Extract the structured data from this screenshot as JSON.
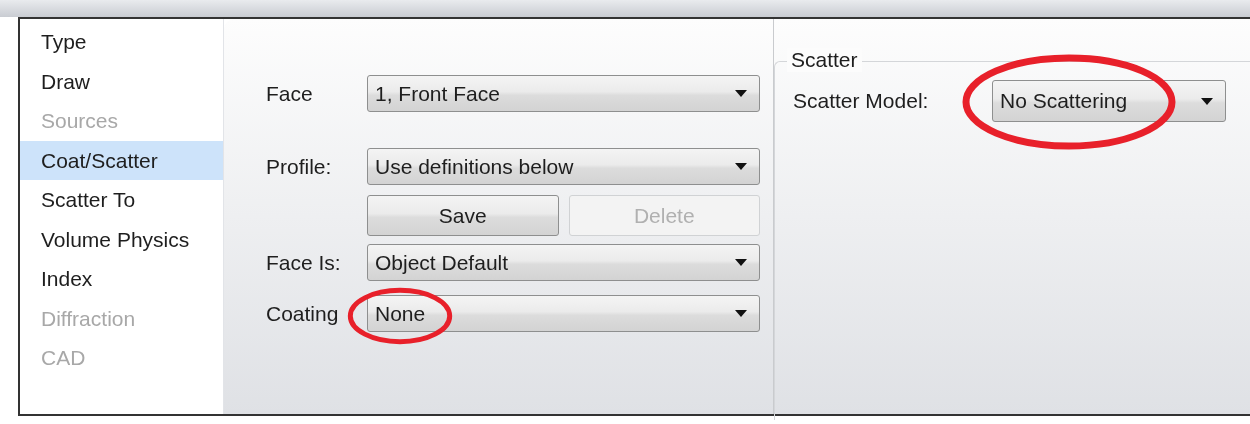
{
  "sidebar": {
    "items": [
      {
        "label": "Type",
        "selected": false,
        "disabled": false
      },
      {
        "label": "Draw",
        "selected": false,
        "disabled": false
      },
      {
        "label": "Sources",
        "selected": false,
        "disabled": true
      },
      {
        "label": "Coat/Scatter",
        "selected": true,
        "disabled": false
      },
      {
        "label": "Scatter To",
        "selected": false,
        "disabled": false
      },
      {
        "label": "Volume Physics",
        "selected": false,
        "disabled": false
      },
      {
        "label": "Index",
        "selected": false,
        "disabled": false
      },
      {
        "label": "Diffraction",
        "selected": false,
        "disabled": true
      },
      {
        "label": "CAD",
        "selected": false,
        "disabled": true
      }
    ]
  },
  "face_panel": {
    "rows": [
      {
        "kind": "dropdown",
        "label": "Face",
        "value": "1, Front Face",
        "highlighted": false
      },
      {
        "kind": "dropdown",
        "label": "Profile:",
        "value": "Use definitions below",
        "highlighted": false
      },
      {
        "kind": "buttons",
        "buttons": [
          {
            "label": "Save",
            "disabled": false
          },
          {
            "label": "Delete",
            "disabled": true
          }
        ]
      },
      {
        "kind": "dropdown",
        "label": "Face Is:",
        "value": "Object Default",
        "highlighted": false
      },
      {
        "kind": "dropdown",
        "label": "Coating",
        "value": "None",
        "highlighted": true
      }
    ]
  },
  "scatter_group": {
    "title": "Scatter",
    "label": "Scatter Model:",
    "value": "No Scattering",
    "highlighted": true
  }
}
